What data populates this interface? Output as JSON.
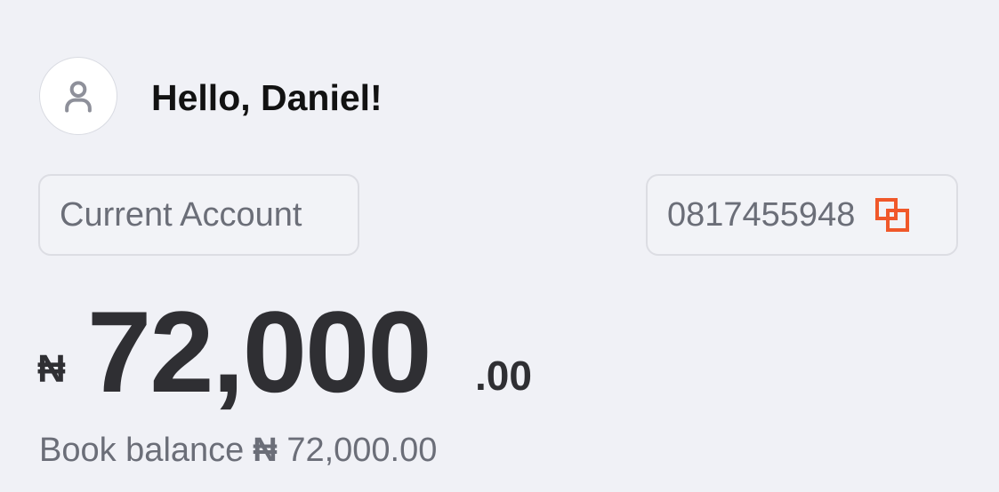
{
  "user": {
    "greeting": "Hello, Daniel!",
    "avatar_icon": "user-icon"
  },
  "account": {
    "type_label": "Current Account",
    "number": "0817455948",
    "copy_icon": "copy-icon"
  },
  "balance": {
    "currency_symbol": "₦",
    "whole": "72,000",
    "fraction": ".00"
  },
  "book_balance": {
    "label": "Book balance",
    "currency_symbol": "₦",
    "value": "72,000.00"
  },
  "colors": {
    "background": "#f0f1f6",
    "accent": "#f0582a",
    "text_dark": "#121212",
    "text_muted": "#6b6e78"
  }
}
